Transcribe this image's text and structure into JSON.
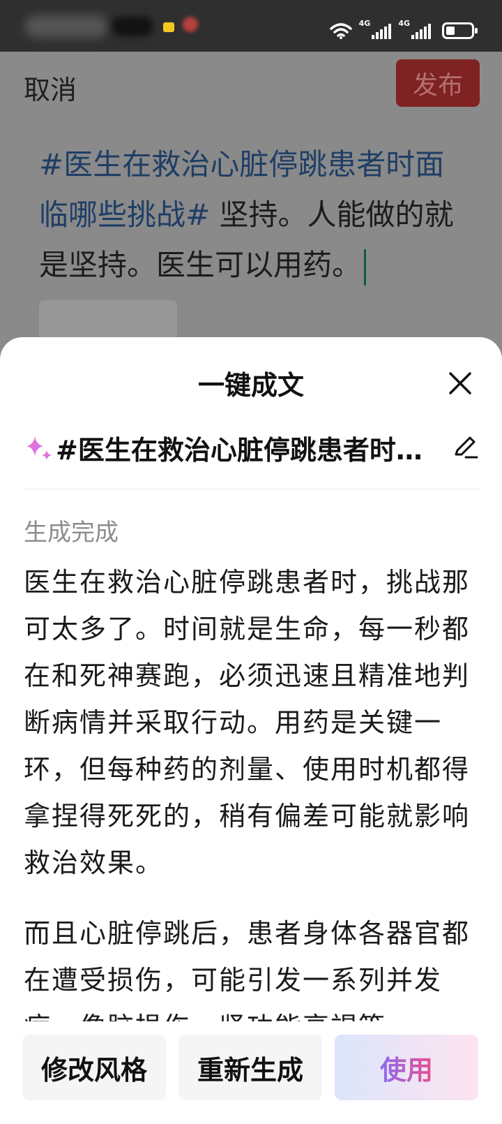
{
  "status_bar": {
    "network_1": "4G",
    "network_2": "4G",
    "icons": [
      "wifi-icon",
      "signal-icon",
      "signal-icon",
      "battery-icon"
    ],
    "battery_level": 0.35
  },
  "editor": {
    "cancel_label": "取消",
    "publish_label": "发布",
    "hashtag": "#医生在救治心脏停跳患者时面临哪些挑战#",
    "body_text": " 坚持。人能做的就是坚持。医生可以用药。"
  },
  "sheet": {
    "title": "一键成文",
    "prompt": "#医生在救治心脏停跳患者时面临哪些挑战# 坚持。人能做的就是坚持。医生可以用药。",
    "status": "生成完成",
    "paragraphs": [
      "医生在救治心脏停跳患者时，挑战那可太多了。时间就是生命，每一秒都在和死神赛跑，必须迅速且精准地判断病情并采取行动。用药是关键一环，但每种药的剂量、使用时机都得拿捏得死死的，稍有偏差可能就影响救治效果。",
      "而且心脏停跳后，患者身体各器官都在遭受损伤，可能引发一系列并发症，像脑损伤、肾功能衰竭等"
    ],
    "buttons": {
      "style_label": "修改风格",
      "regenerate_label": "重新生成",
      "use_label": "使用"
    }
  },
  "colors": {
    "accent_publish": "#7f2222",
    "hashtag": "#1f3e66",
    "use_gradient_start": "#8a6cf1",
    "use_gradient_end": "#ea4e8c"
  }
}
